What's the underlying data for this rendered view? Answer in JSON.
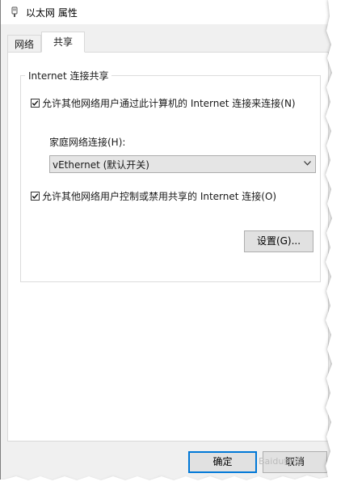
{
  "window": {
    "title": "以太网 属性",
    "icon": "network-adapter-icon"
  },
  "tabs": [
    {
      "label": "网络",
      "selected": false
    },
    {
      "label": "共享",
      "selected": true
    }
  ],
  "ics": {
    "group_title": "Internet 连接共享",
    "allow_connect": {
      "label": "允许其他网络用户通过此计算机的 Internet 连接来连接(N)",
      "checked": true
    },
    "home_network": {
      "label": "家庭网络连接(H):",
      "selected_value": "vEthernet (默认开关)"
    },
    "allow_control": {
      "label": "允许其他网络用户控制或禁用共享的 Internet 连接(O)",
      "checked": true
    },
    "settings_button": "设置(G)..."
  },
  "footer": {
    "ok_label": "确定",
    "cancel_label": "取消"
  },
  "watermark": "Baidu经验"
}
